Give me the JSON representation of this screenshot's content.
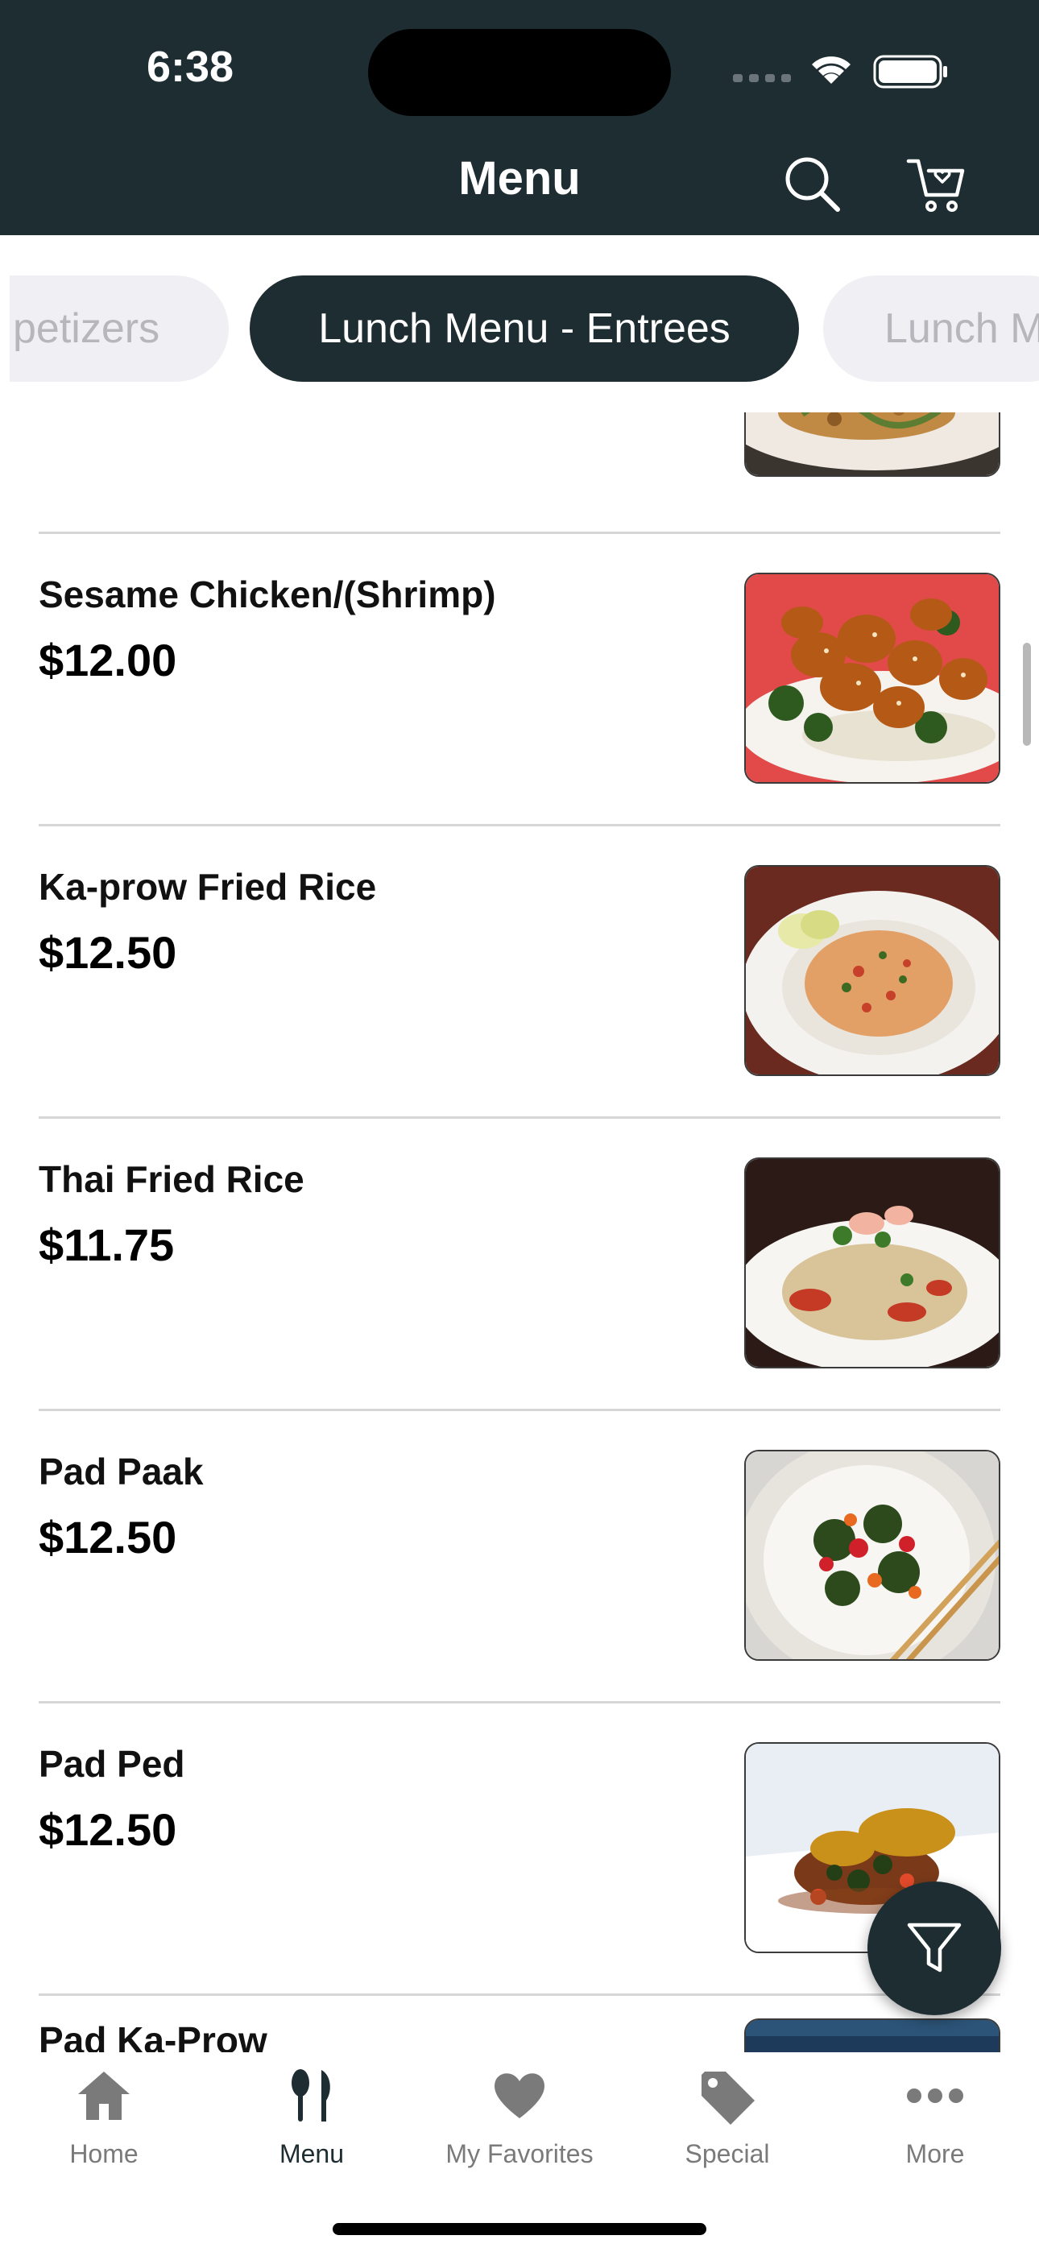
{
  "status": {
    "time": "6:38"
  },
  "header": {
    "title": "Menu",
    "search_icon": "search-icon",
    "cart_icon": "cart-icon"
  },
  "colors": {
    "header_bg": "#1e2d32",
    "accent": "#1e2d32",
    "inactive_tab_bg": "#f0f0f4",
    "inactive_tab_text": "#b6b6bc"
  },
  "categories": {
    "prev": "petizers",
    "active": "Lunch Menu - Entrees",
    "next": "Lunch M"
  },
  "items": [
    {
      "name": "Sesame Chicken/(Shrimp)",
      "price": "$12.00"
    },
    {
      "name": "Ka-prow Fried Rice",
      "price": "$12.50"
    },
    {
      "name": "Thai Fried Rice",
      "price": "$11.75"
    },
    {
      "name": "Pad Paak",
      "price": "$12.50"
    },
    {
      "name": "Pad Ped",
      "price": "$12.50"
    },
    {
      "name": "Pad Ka-Prow",
      "price": ""
    }
  ],
  "fab": {
    "icon": "filter-icon"
  },
  "tabbar": [
    {
      "label": "Home",
      "icon": "home-icon",
      "active": false
    },
    {
      "label": "Menu",
      "icon": "menu-utensils-icon",
      "active": true
    },
    {
      "label": "My Favorites",
      "icon": "heart-icon",
      "active": false
    },
    {
      "label": "Special",
      "icon": "tag-icon",
      "active": false
    },
    {
      "label": "More",
      "icon": "more-dots-icon",
      "active": false
    }
  ]
}
